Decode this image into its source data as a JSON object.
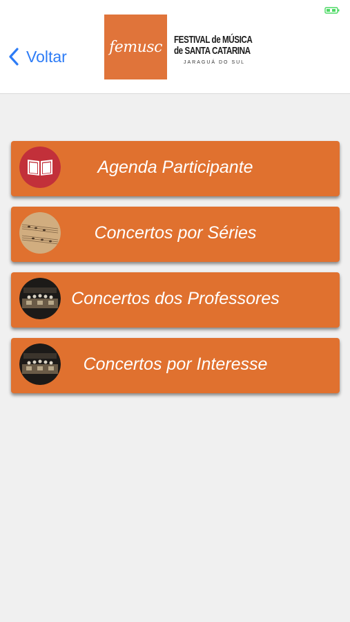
{
  "status_bar": {
    "battery_icon": "battery-icon",
    "battery_color": "#4cd964"
  },
  "header": {
    "back_label": "Voltar",
    "back_icon": "chevron-left-icon",
    "logo_text": "femusc",
    "logo_line1": "FESTIVAL de MÚSICA",
    "logo_line2": "de SANTA CATARINA",
    "logo_line3": "JARAGUÁ DO SUL",
    "brand_color": "#e0743a"
  },
  "menu": {
    "items": [
      {
        "label": "Agenda Participante",
        "icon": "book-icon"
      },
      {
        "label": "Concertos por Séries",
        "icon": "sheet-music-icon"
      },
      {
        "label": "Concertos dos Professores",
        "icon": "orchestra-icon"
      },
      {
        "label": "Concertos por Interesse",
        "icon": "orchestra-icon"
      }
    ],
    "button_color": "#e0712f"
  }
}
